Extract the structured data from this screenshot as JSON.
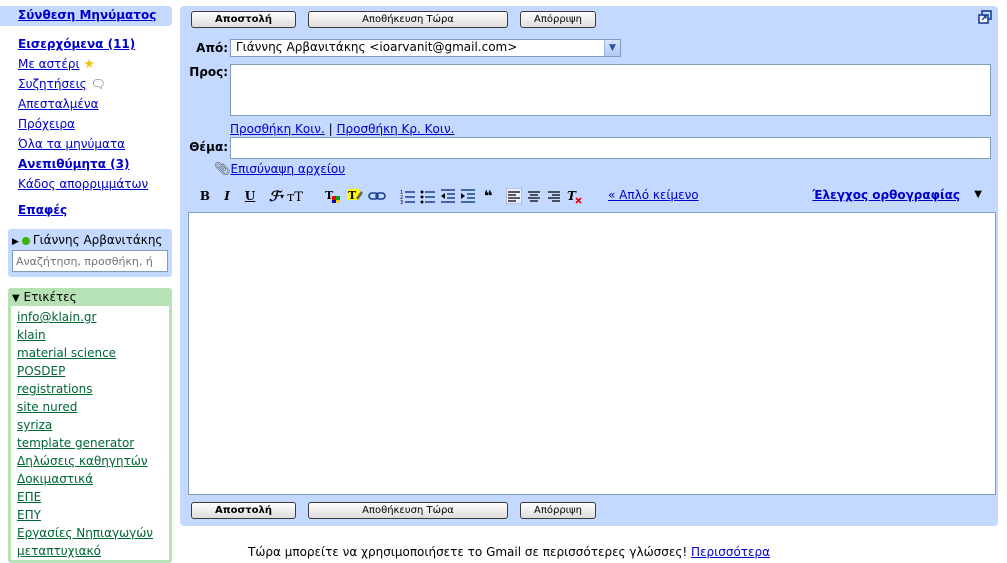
{
  "nav": {
    "compose": "Σύνθεση Μηνύματος",
    "items": [
      {
        "label": "Εισερχόμενα (11)",
        "bold": true
      },
      {
        "label": "Με αστέρι",
        "icon": "star-icon"
      },
      {
        "label": "Συζητήσεις",
        "icon": "chat-icon"
      },
      {
        "label": "Απεσταλμένα"
      },
      {
        "label": "Πρόχειρα"
      },
      {
        "label": "Όλα τα μηνύματα"
      },
      {
        "label": "Ανεπιθύμητα (3)",
        "bold": true
      },
      {
        "label": "Κάδος απορριμμάτων"
      }
    ],
    "contacts": "Επαφές"
  },
  "chat": {
    "user": "Γιάννης Αρβανιτάκης",
    "status_color": "#3cb300",
    "search_placeholder": "Αναζήτηση, προσθήκη, ή"
  },
  "labels": {
    "header": "Ετικέτες",
    "items": [
      "info@klain.gr",
      "klain",
      "material science",
      "POSDEP",
      "registrations",
      "site nured",
      "syriza",
      "template generator",
      "Δηλώσεις καθηγητών",
      "Δοκιμαστικά",
      "ΕΠΕ",
      "ΕΠΥ",
      "Εργασίες Νηπιαγωγών",
      "μεταπτυχιακό"
    ]
  },
  "compose": {
    "send": "Αποστολή",
    "save_now": "Αποθήκευση Τώρα",
    "discard": "Απόρριψη",
    "from_label": "Από:",
    "from_value": "Γιάννης Αρβανιτάκης <ioarvanit@gmail.com>",
    "to_label": "Προς:",
    "add_cc": "Προσθήκη Κοιν.",
    "separator": "|",
    "add_bcc": "Προσθήκη Κρ. Κοιν.",
    "subject_label": "Θέμα:",
    "attach": "Επισύναψη αρχείου",
    "plain_text": "« Απλό κείμενο",
    "spell_check": "Έλεγχος ορθογραφίας"
  },
  "footer": {
    "text": "Τώρα μπορείτε να χρησιμοποιήσετε το Gmail σε περισσότερες γλώσσες!",
    "more": "Περισσότερα"
  },
  "colors": {
    "panel": "#c3d9ff",
    "labels_border": "#b6e2b6",
    "link": "#0000cc"
  }
}
